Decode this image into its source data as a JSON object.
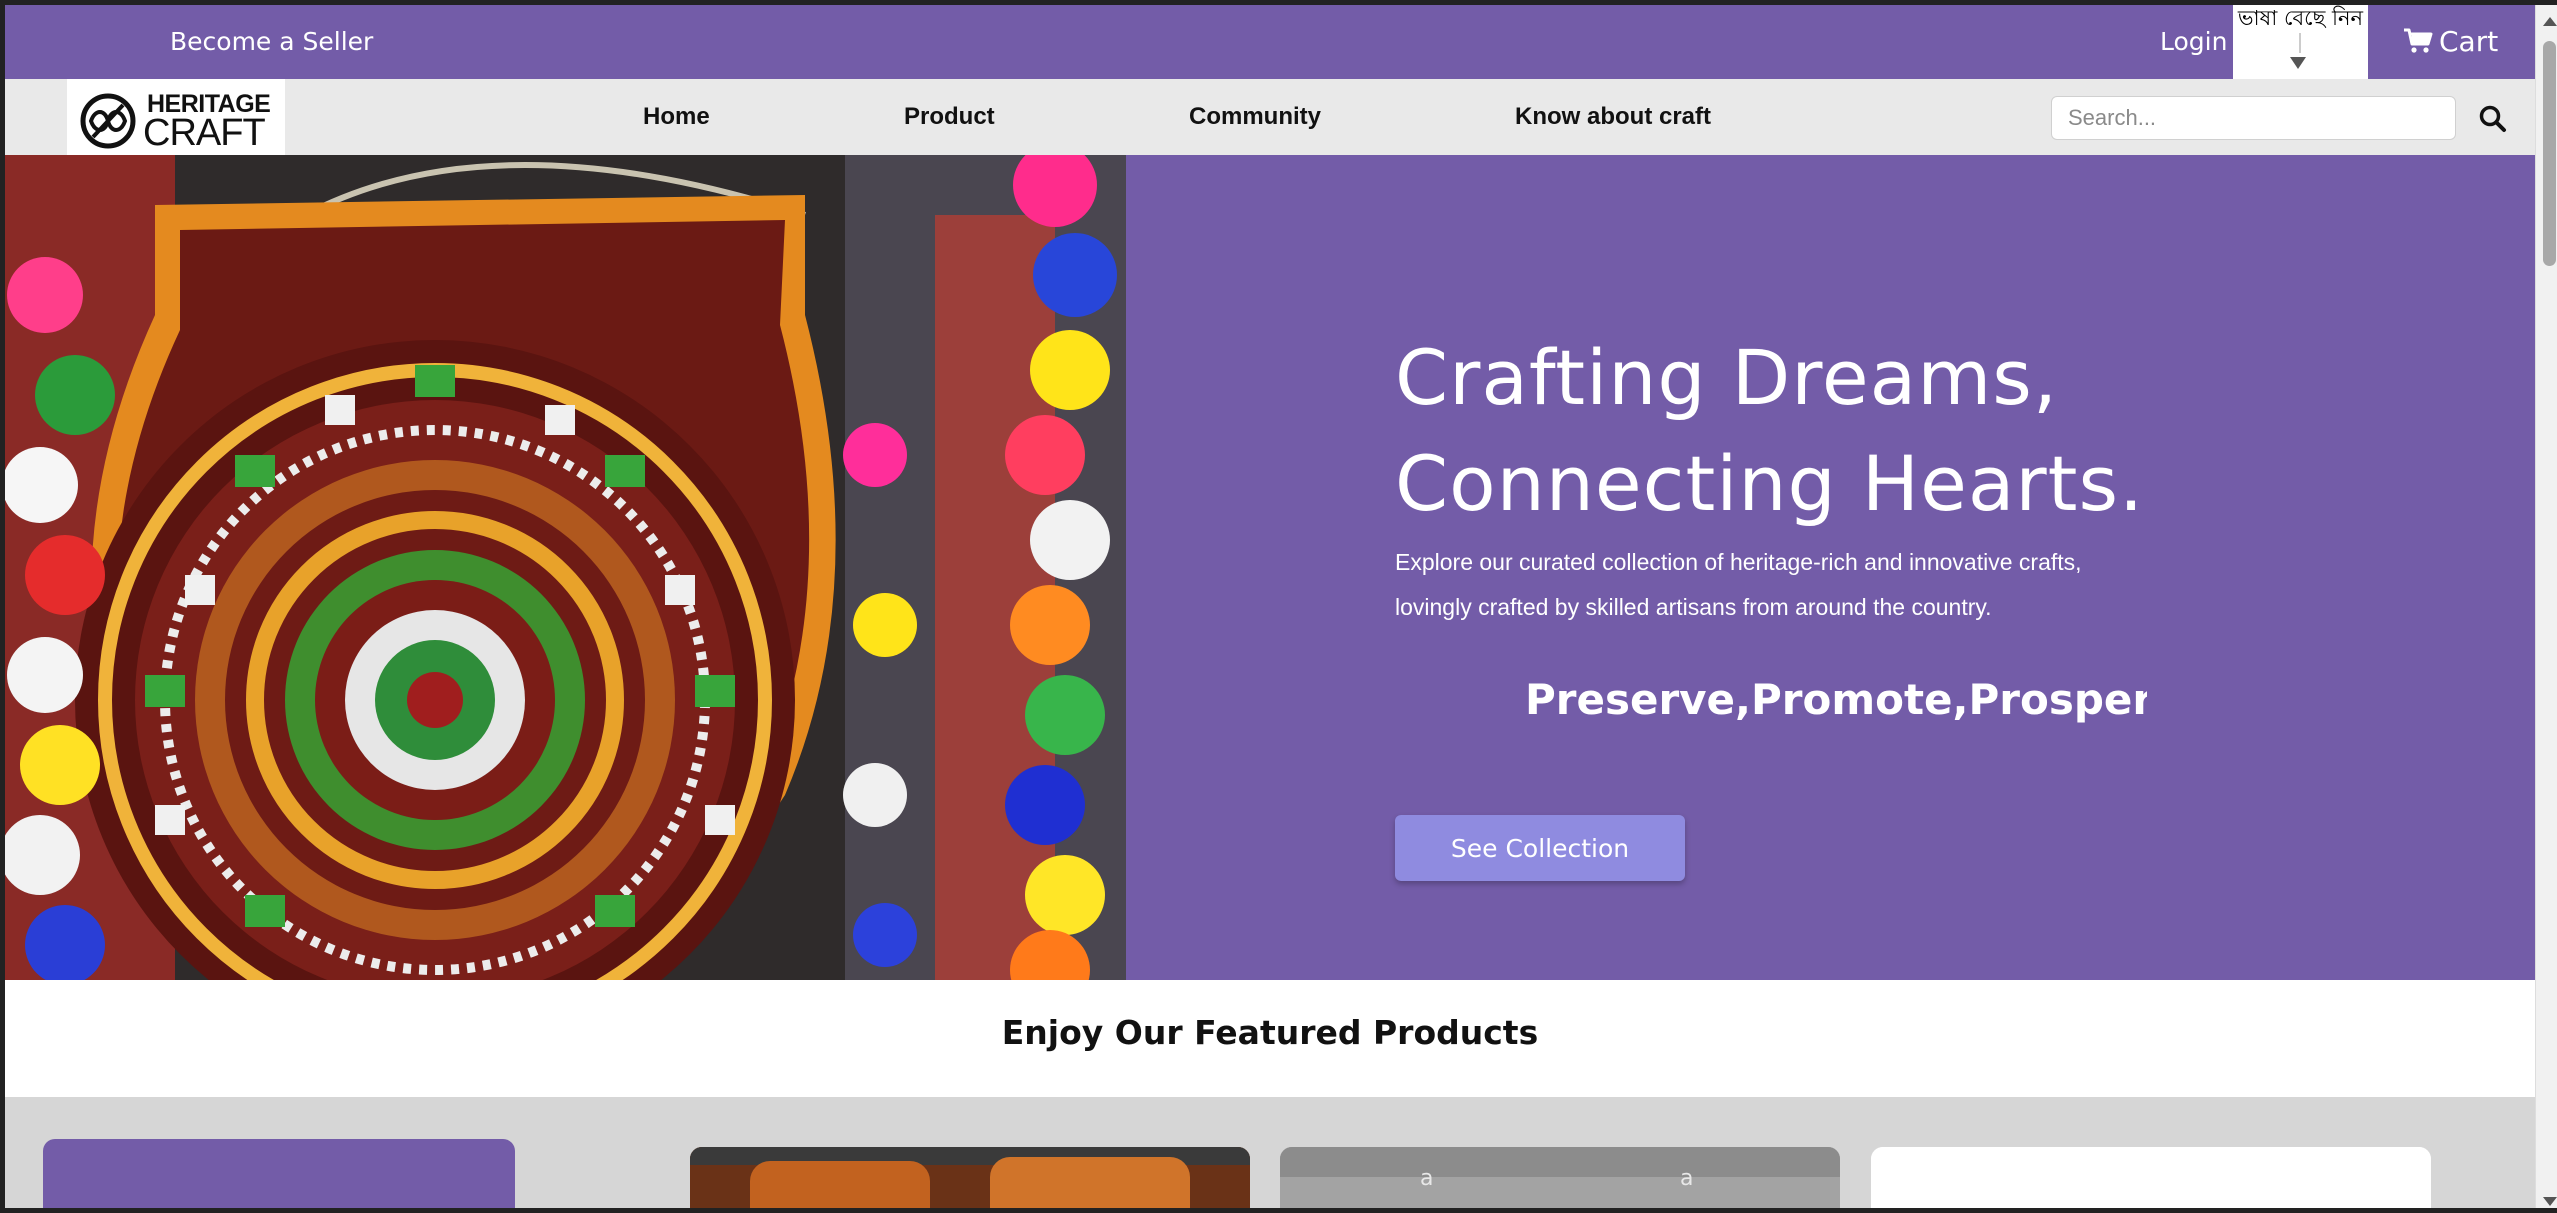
{
  "topbar": {
    "seller_label": "Become a Seller",
    "login_label": "Login",
    "language_label": "ভাষা বেছে নিন",
    "cart_label": "Cart"
  },
  "brand": {
    "line1": "HERITAGE",
    "line2": "CRAFT"
  },
  "nav": {
    "items": [
      {
        "label": "Home"
      },
      {
        "label": "Product"
      },
      {
        "label": "Community"
      },
      {
        "label": "Know about craft"
      }
    ]
  },
  "search": {
    "placeholder": "Search...",
    "value": ""
  },
  "hero": {
    "title_line1": "Crafting Dreams,",
    "title_line2": "Connecting Hearts.",
    "description": "Explore our curated collection of heritage-rich and innovative crafts, lovingly crafted by skilled artisans from around the country.",
    "marquee": "Preserve,Promote,Prosper: Joi",
    "button_label": "See Collection"
  },
  "featured": {
    "title": "Enjoy Our Featured Products"
  },
  "colors": {
    "brand_purple": "#735ca8",
    "button_lavender": "#8f8be0",
    "nav_bg": "#e9e9e9"
  },
  "icons": {
    "cart": "cart-icon",
    "search": "search-icon",
    "dropdown": "dropdown-arrow-icon"
  }
}
